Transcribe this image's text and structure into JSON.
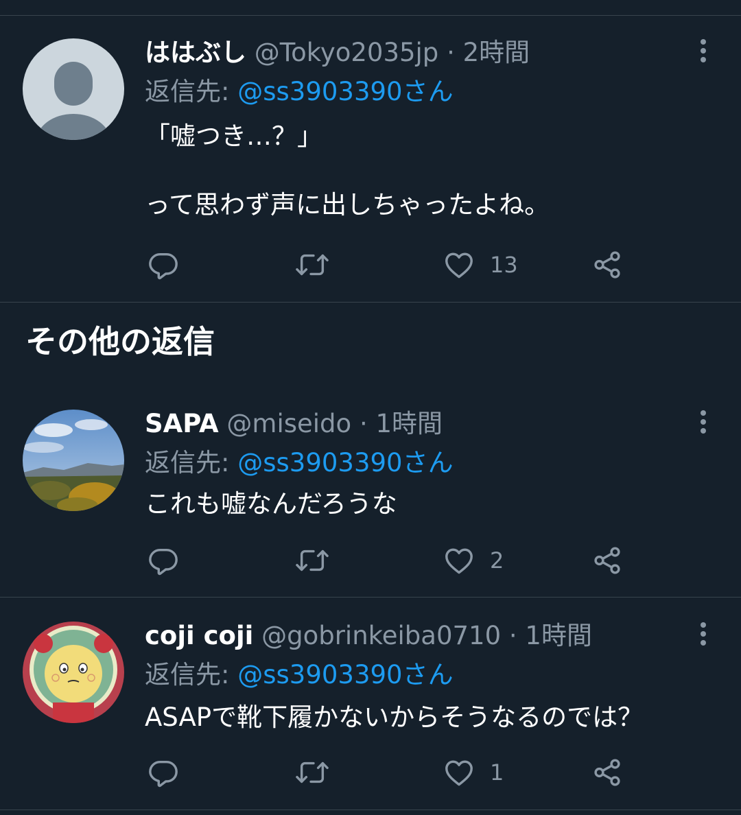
{
  "replies": [
    {
      "name": "ははぶし",
      "handle": "@Tokyo2035jp",
      "sep": "·",
      "time": "2時間",
      "reply_prefix": "返信先: ",
      "reply_to": "@ss3903390さん",
      "text": "「嘘つき…？」\n\nって思わず声に出しちゃったよね。",
      "likes": "13"
    }
  ],
  "section_title": "その他の返信",
  "more_replies": [
    {
      "name": "SAPA",
      "handle": "@miseido",
      "sep": "·",
      "time": "1時間",
      "reply_prefix": "返信先: ",
      "reply_to": "@ss3903390さん",
      "text": "これも嘘なんだろうな",
      "likes": "2"
    },
    {
      "name": "coji coji",
      "handle": "@gobrinkeiba0710",
      "sep": "·",
      "time": "1時間",
      "reply_prefix": "返信先: ",
      "reply_to": "@ss3903390さん",
      "text": "ASAPで靴下履かないからそうなるのでは？",
      "likes": "1"
    }
  ],
  "icons": {
    "reply": "reply-icon",
    "retweet": "retweet-icon",
    "like": "heart-icon",
    "share": "share-icon",
    "more": "more-vertical-icon"
  },
  "colors": {
    "background": "#15202b",
    "divider": "#38444d",
    "secondary_text": "#8b98a5",
    "link": "#1d9bf0"
  }
}
